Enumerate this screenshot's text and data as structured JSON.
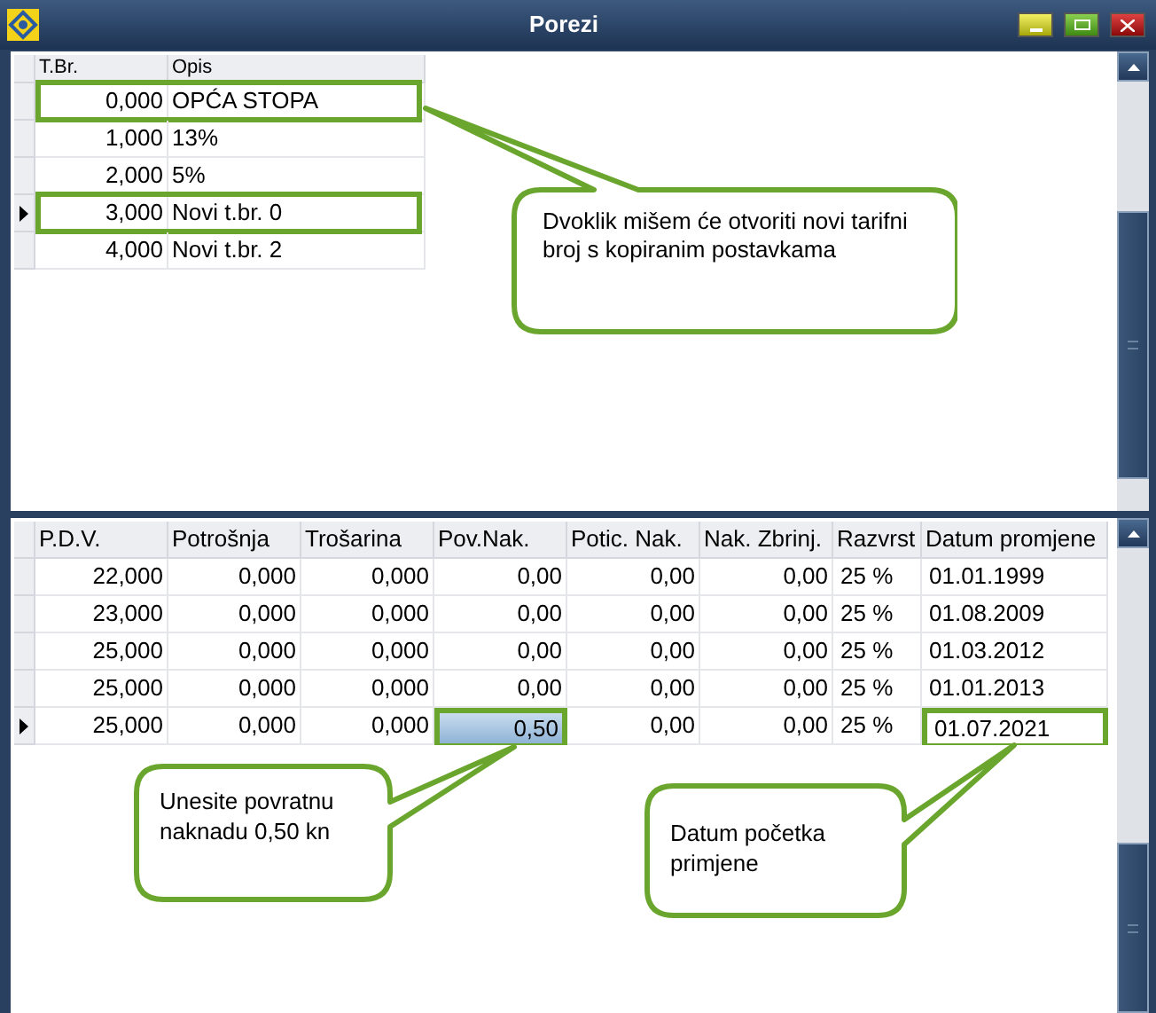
{
  "window": {
    "title": "Porezi"
  },
  "top_table": {
    "columns": [
      "T.Br.",
      "Opis"
    ],
    "rows": [
      {
        "cells": [
          "0,000",
          "OPĆA STOPA"
        ],
        "selected": false,
        "framed": true
      },
      {
        "cells": [
          "1,000",
          "13%"
        ],
        "selected": false,
        "framed": false
      },
      {
        "cells": [
          "2,000",
          "5%"
        ],
        "selected": false,
        "framed": false
      },
      {
        "cells": [
          "3,000",
          "Novi t.br. 0"
        ],
        "selected": true,
        "framed": true
      },
      {
        "cells": [
          "4,000",
          "Novi t.br. 2"
        ],
        "selected": false,
        "framed": false
      }
    ]
  },
  "bottom_table": {
    "columns": [
      "P.D.V.",
      "Potrošnja",
      "Trošarina",
      "Pov.Nak.",
      "Potic. Nak.",
      "Nak. Zbrinj.",
      "Razvrst",
      "Datum promjene"
    ],
    "rows": [
      {
        "selected": false,
        "cells": [
          {
            "text": "22,000",
            "framed": false,
            "active": false
          },
          {
            "text": "0,000",
            "framed": false,
            "active": false
          },
          {
            "text": "0,000",
            "framed": false,
            "active": false
          },
          {
            "text": "0,00",
            "framed": false,
            "active": false
          },
          {
            "text": "0,00",
            "framed": false,
            "active": false
          },
          {
            "text": "0,00",
            "framed": false,
            "active": false
          },
          {
            "text": "25 %",
            "framed": false,
            "active": false
          },
          {
            "text": "01.01.1999",
            "framed": false,
            "active": false
          }
        ]
      },
      {
        "selected": false,
        "cells": [
          {
            "text": "23,000",
            "framed": false,
            "active": false
          },
          {
            "text": "0,000",
            "framed": false,
            "active": false
          },
          {
            "text": "0,000",
            "framed": false,
            "active": false
          },
          {
            "text": "0,00",
            "framed": false,
            "active": false
          },
          {
            "text": "0,00",
            "framed": false,
            "active": false
          },
          {
            "text": "0,00",
            "framed": false,
            "active": false
          },
          {
            "text": "25 %",
            "framed": false,
            "active": false
          },
          {
            "text": "01.08.2009",
            "framed": false,
            "active": false
          }
        ]
      },
      {
        "selected": false,
        "cells": [
          {
            "text": "25,000",
            "framed": false,
            "active": false
          },
          {
            "text": "0,000",
            "framed": false,
            "active": false
          },
          {
            "text": "0,000",
            "framed": false,
            "active": false
          },
          {
            "text": "0,00",
            "framed": false,
            "active": false
          },
          {
            "text": "0,00",
            "framed": false,
            "active": false
          },
          {
            "text": "0,00",
            "framed": false,
            "active": false
          },
          {
            "text": "25 %",
            "framed": false,
            "active": false
          },
          {
            "text": "01.03.2012",
            "framed": false,
            "active": false
          }
        ]
      },
      {
        "selected": false,
        "cells": [
          {
            "text": "25,000",
            "framed": false,
            "active": false
          },
          {
            "text": "0,000",
            "framed": false,
            "active": false
          },
          {
            "text": "0,000",
            "framed": false,
            "active": false
          },
          {
            "text": "0,00",
            "framed": false,
            "active": false
          },
          {
            "text": "0,00",
            "framed": false,
            "active": false
          },
          {
            "text": "0,00",
            "framed": false,
            "active": false
          },
          {
            "text": "25 %",
            "framed": false,
            "active": false
          },
          {
            "text": "01.01.2013",
            "framed": false,
            "active": false
          }
        ]
      },
      {
        "selected": true,
        "cells": [
          {
            "text": "25,000",
            "framed": false,
            "active": false
          },
          {
            "text": "0,000",
            "framed": false,
            "active": false
          },
          {
            "text": "0,000",
            "framed": false,
            "active": false
          },
          {
            "text": "0,50",
            "framed": true,
            "active": true
          },
          {
            "text": "0,00",
            "framed": false,
            "active": false
          },
          {
            "text": "0,00",
            "framed": false,
            "active": false
          },
          {
            "text": "25 %",
            "framed": false,
            "active": false
          },
          {
            "text": "01.07.2021",
            "framed": true,
            "active": false
          }
        ]
      }
    ]
  },
  "callouts": [
    {
      "text": "Dvoklik mišem će otvoriti novi tarifni broj s kopiranim postavkama"
    },
    {
      "text": "Unesite povratnu naknadu 0,50 kn"
    },
    {
      "text": "Datum početka primjene"
    }
  ]
}
